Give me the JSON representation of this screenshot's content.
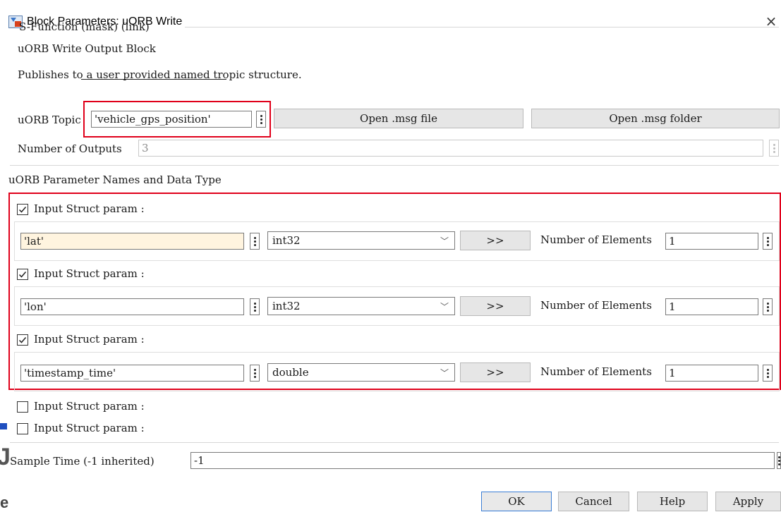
{
  "window": {
    "title": "Block Parameters: uORB Write",
    "close_glyph": "×"
  },
  "header": {
    "group_label": "S-Function (mask) (link)",
    "block_name": "uORB Write Output Block",
    "description": "Publishes to a user provided named tropic structure."
  },
  "topic": {
    "label": "uORB Topic",
    "value": "'vehicle_gps_position'",
    "open_msg_file": "Open .msg file",
    "open_msg_folder": "Open .msg folder"
  },
  "outputs": {
    "label": "Number of Outputs",
    "value": "3"
  },
  "params_section": {
    "title": "uORB Parameter Names and Data Type",
    "checkbox_label": "Input Struct param :",
    "expand_label": ">>",
    "elements_label": "Number of Elements",
    "rows": [
      {
        "checked": true,
        "name": "'lat'",
        "type": "int32",
        "elements": "1"
      },
      {
        "checked": true,
        "name": "'lon'",
        "type": "int32",
        "elements": "1"
      },
      {
        "checked": true,
        "name": "'timestamp_time'",
        "type": "double",
        "elements": "1"
      }
    ],
    "unchecked": [
      {
        "label": "Input Struct param :",
        "checked": false
      },
      {
        "label": "Input Struct param :",
        "checked": false
      }
    ]
  },
  "sample_time": {
    "label": "Sample Time (-1 inherited)",
    "value": "-1"
  },
  "footer": {
    "ok": "OK",
    "cancel": "Cancel",
    "help": "Help",
    "apply": "Apply"
  },
  "behind_fragments": {
    "letter1": "J",
    "letter2": "e"
  },
  "colors": {
    "annotation_red": "#e0001a",
    "default_button_border": "#3c7fd6"
  },
  "icons": [
    "simulink-block-icon",
    "close-icon",
    "kebab-dots-icon",
    "chevron-down-icon",
    "checkmark-icon"
  ]
}
